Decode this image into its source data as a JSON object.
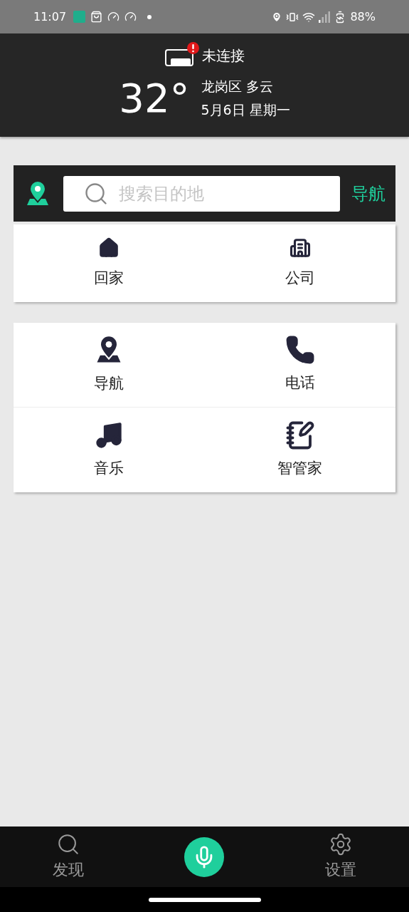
{
  "status_bar": {
    "time": "11:07",
    "battery": "88%"
  },
  "header": {
    "connection": "未连接",
    "temperature": "32°",
    "weather": "龙岗区 多云",
    "date": "5月6日 星期一"
  },
  "search": {
    "placeholder": "搜索目的地",
    "action": "导航"
  },
  "shortcuts": [
    {
      "label": "回家"
    },
    {
      "label": "公司"
    }
  ],
  "features": [
    {
      "label": "导航"
    },
    {
      "label": "电话"
    },
    {
      "label": "音乐"
    },
    {
      "label": "智管家"
    }
  ],
  "bottom_nav": [
    {
      "label": "发现"
    },
    {
      "label": "设置"
    }
  ]
}
